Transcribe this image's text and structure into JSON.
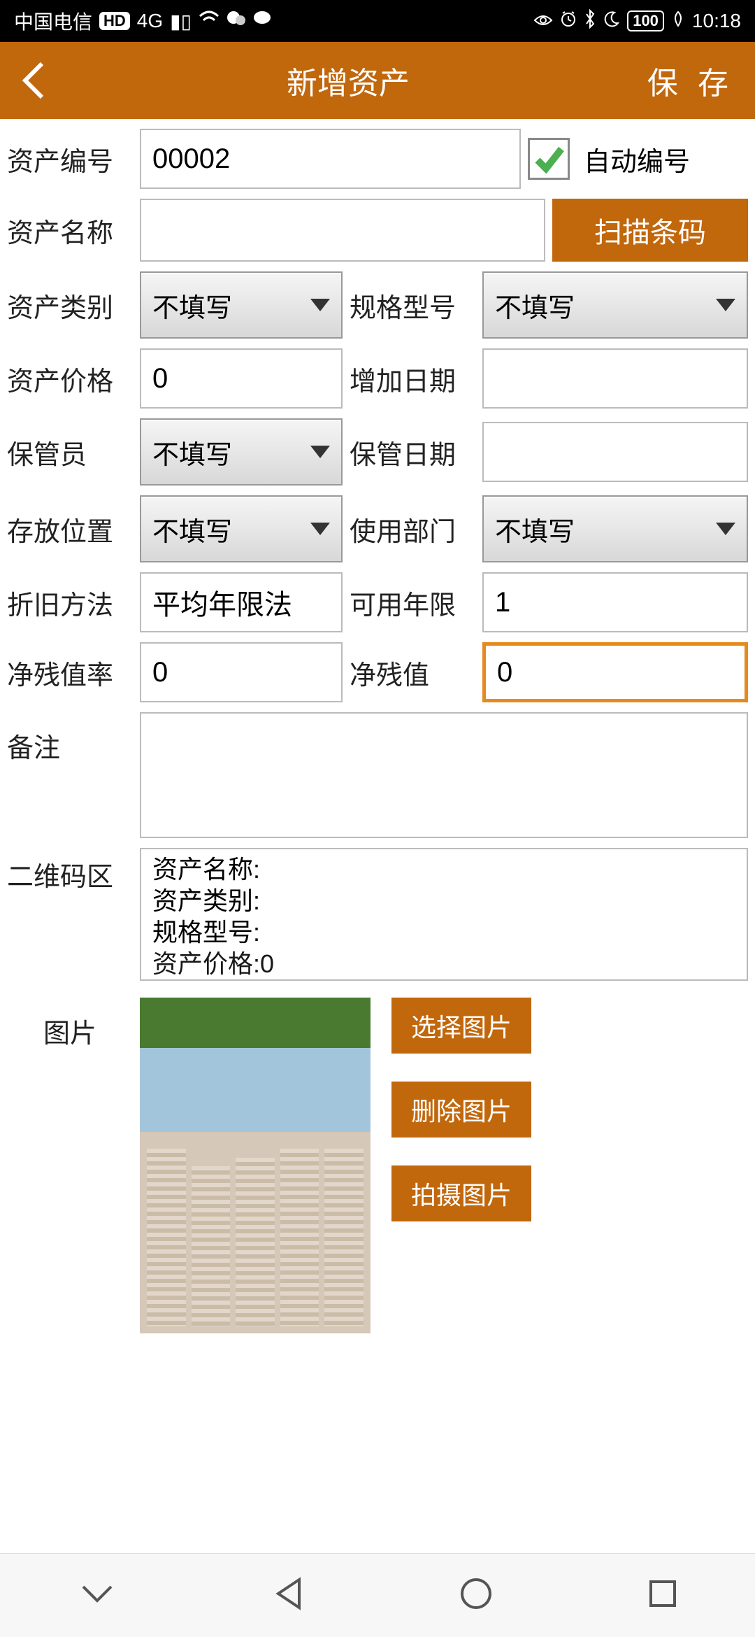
{
  "status": {
    "carrier": "中国电信",
    "hd": "HD",
    "signal": "4G",
    "battery_pct": "100",
    "time": "10:18"
  },
  "header": {
    "title": "新增资产",
    "save": "保 存"
  },
  "labels": {
    "asset_no": "资产编号",
    "auto_no": "自动编号",
    "asset_name": "资产名称",
    "scan": "扫描条码",
    "asset_category": "资产类别",
    "spec_model": "规格型号",
    "asset_price": "资产价格",
    "add_date": "增加日期",
    "custodian": "保管员",
    "custody_date": "保管日期",
    "location": "存放位置",
    "department": "使用部门",
    "depreciation": "折旧方法",
    "usable_years": "可用年限",
    "residual_rate": "净残值率",
    "residual_value": "净残值",
    "remark": "备注",
    "qr_area": "二维码区",
    "image": "图片",
    "choose_image": "选择图片",
    "delete_image": "删除图片",
    "take_photo": "拍摄图片"
  },
  "values": {
    "asset_no": "00002",
    "asset_name": "",
    "asset_category": "不填写",
    "spec_model": "不填写",
    "asset_price": "0",
    "add_date": "",
    "custodian": "不填写",
    "custody_date": "",
    "location": "不填写",
    "department": "不填写",
    "depreciation": "平均年限法",
    "usable_years": "1",
    "residual_rate": "0",
    "residual_value": "0",
    "remark": "",
    "qr_line1": "资产名称:",
    "qr_line2": "资产类别:",
    "qr_line3": "规格型号:",
    "qr_line4": "资产价格:0"
  }
}
